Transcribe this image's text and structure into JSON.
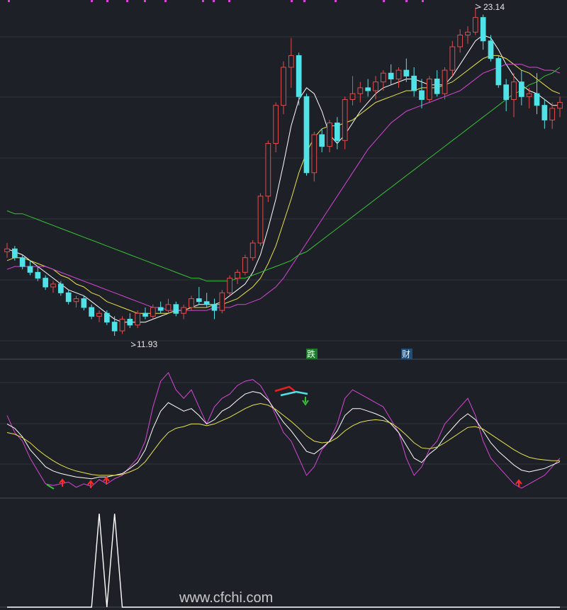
{
  "chart_data": [
    {
      "type": "candlestick",
      "panel": "main",
      "annotations": {
        "high_label": "23.14",
        "low_label": "11.93",
        "signal_1": "跌",
        "signal_2": "财"
      },
      "colors": {
        "up": "#e14c4c",
        "down": "#4fe3e8",
        "ma_short": "#ffffff",
        "ma_mid": "#e8e24a",
        "ma_long": "#d646d6",
        "ma_longest": "#35c235",
        "grid": "#30333b",
        "border": "#4a4d55"
      },
      "grid": true,
      "candles_ohlc": [
        [
          14.8,
          15.1,
          14.6,
          14.9
        ],
        [
          14.9,
          15.0,
          14.5,
          14.6
        ],
        [
          14.6,
          14.7,
          14.2,
          14.3
        ],
        [
          14.3,
          14.5,
          14.0,
          14.1
        ],
        [
          14.1,
          14.3,
          13.8,
          13.9
        ],
        [
          13.9,
          14.0,
          13.5,
          13.6
        ],
        [
          13.6,
          13.8,
          13.4,
          13.7
        ],
        [
          13.7,
          13.8,
          13.3,
          13.4
        ],
        [
          13.4,
          13.5,
          13.0,
          13.1
        ],
        [
          13.1,
          13.3,
          12.9,
          13.2
        ],
        [
          13.2,
          13.3,
          12.8,
          12.9
        ],
        [
          12.9,
          13.0,
          12.5,
          12.6
        ],
        [
          12.6,
          12.8,
          12.4,
          12.7
        ],
        [
          12.7,
          12.8,
          12.3,
          12.4
        ],
        [
          12.4,
          12.6,
          11.93,
          12.1
        ],
        [
          12.1,
          12.6,
          12.0,
          12.5
        ],
        [
          12.5,
          12.7,
          12.2,
          12.3
        ],
        [
          12.3,
          12.8,
          12.2,
          12.7
        ],
        [
          12.7,
          12.9,
          12.5,
          12.6
        ],
        [
          12.6,
          13.0,
          12.5,
          12.9
        ],
        [
          12.9,
          13.1,
          12.7,
          12.8
        ],
        [
          12.8,
          13.2,
          12.7,
          13.0
        ],
        [
          13.0,
          13.1,
          12.6,
          12.7
        ],
        [
          12.7,
          13.0,
          12.5,
          12.9
        ],
        [
          12.9,
          13.3,
          12.8,
          13.2
        ],
        [
          13.2,
          13.6,
          13.0,
          13.1
        ],
        [
          13.1,
          13.4,
          12.9,
          13.0
        ],
        [
          13.0,
          13.2,
          12.5,
          12.8
        ],
        [
          12.8,
          13.5,
          12.7,
          13.4
        ],
        [
          13.4,
          14.0,
          13.3,
          13.9
        ],
        [
          13.9,
          14.2,
          13.7,
          14.1
        ],
        [
          14.1,
          14.7,
          14.0,
          14.6
        ],
        [
          14.6,
          15.2,
          14.5,
          15.1
        ],
        [
          15.1,
          16.8,
          15.0,
          16.7
        ],
        [
          16.7,
          18.6,
          16.5,
          18.5
        ],
        [
          18.5,
          19.9,
          18.2,
          19.8
        ],
        [
          19.8,
          21.3,
          19.5,
          21.1
        ],
        [
          21.1,
          22.1,
          20.4,
          21.5
        ],
        [
          21.5,
          21.6,
          19.8,
          20.1
        ],
        [
          20.1,
          20.2,
          17.4,
          17.5
        ],
        [
          17.5,
          18.9,
          17.2,
          18.8
        ],
        [
          18.8,
          19.0,
          18.2,
          18.4
        ],
        [
          18.4,
          19.3,
          18.2,
          19.2
        ],
        [
          19.2,
          19.4,
          18.3,
          18.6
        ],
        [
          18.6,
          20.1,
          18.3,
          20.0
        ],
        [
          20.0,
          20.8,
          19.8,
          20.2
        ],
        [
          20.2,
          20.6,
          19.9,
          20.4
        ],
        [
          20.4,
          20.7,
          20.1,
          20.3
        ],
        [
          20.3,
          20.8,
          20.0,
          20.6
        ],
        [
          20.6,
          21.0,
          20.3,
          20.9
        ],
        [
          20.9,
          21.2,
          20.5,
          20.7
        ],
        [
          20.7,
          21.1,
          20.4,
          21.0
        ],
        [
          21.0,
          21.4,
          20.6,
          20.8
        ],
        [
          20.8,
          21.1,
          20.1,
          20.3
        ],
        [
          20.3,
          20.7,
          19.7,
          20.0
        ],
        [
          20.0,
          20.8,
          19.9,
          20.7
        ],
        [
          20.7,
          21.0,
          20.1,
          20.2
        ],
        [
          20.2,
          21.1,
          20.0,
          21.0
        ],
        [
          21.0,
          22.0,
          20.8,
          21.8
        ],
        [
          21.8,
          22.4,
          21.6,
          22.2
        ],
        [
          22.2,
          22.5,
          21.9,
          22.3
        ],
        [
          22.3,
          23.14,
          22.2,
          22.8
        ],
        [
          22.8,
          22.9,
          21.7,
          22.0
        ],
        [
          22.0,
          22.2,
          21.3,
          21.4
        ],
        [
          21.4,
          21.5,
          20.4,
          20.5
        ],
        [
          20.5,
          20.7,
          19.6,
          20.0
        ],
        [
          20.0,
          20.9,
          19.4,
          20.6
        ],
        [
          20.6,
          21.0,
          19.8,
          20.1
        ],
        [
          20.1,
          20.4,
          19.7,
          20.2
        ],
        [
          20.2,
          20.9,
          19.5,
          19.8
        ],
        [
          19.8,
          20.0,
          19.0,
          19.3
        ],
        [
          19.3,
          19.9,
          19.0,
          19.7
        ],
        [
          19.7,
          20.1,
          19.4,
          19.9
        ]
      ],
      "ma_series": [
        {
          "values": [
            14.9,
            14.8,
            14.7,
            14.5,
            14.3,
            14.1,
            13.9,
            13.7,
            13.5,
            13.4,
            13.3,
            13.1,
            12.9,
            12.7,
            12.5,
            12.4,
            12.4,
            12.4,
            12.4,
            12.5,
            12.6,
            12.7,
            12.8,
            12.8,
            12.9,
            13.0,
            13.0,
            13.0,
            13.1,
            13.3,
            13.5,
            13.7,
            14.1,
            14.7,
            15.6,
            16.6,
            17.8,
            19.1,
            20.0,
            20.4,
            20.2,
            19.6,
            18.8,
            18.5,
            18.8,
            19.2,
            19.6,
            19.9,
            20.2,
            20.4,
            20.5,
            20.6,
            20.7,
            20.7,
            20.6,
            20.5,
            20.5,
            20.5,
            20.8,
            21.2,
            21.6,
            22.0,
            22.2,
            22.1,
            21.7,
            21.2,
            20.8,
            20.5,
            20.3,
            20.2,
            20.0,
            19.8,
            19.8
          ]
        },
        {
          "values": [
            14.5,
            14.6,
            14.6,
            14.5,
            14.4,
            14.3,
            14.2,
            14.0,
            13.9,
            13.7,
            13.6,
            13.4,
            13.3,
            13.1,
            13.0,
            12.9,
            12.8,
            12.7,
            12.7,
            12.7,
            12.7,
            12.7,
            12.8,
            12.8,
            12.9,
            12.9,
            12.9,
            13.0,
            13.0,
            13.1,
            13.2,
            13.4,
            13.6,
            13.9,
            14.4,
            15.0,
            15.8,
            16.6,
            17.5,
            18.2,
            18.7,
            19.0,
            19.1,
            19.1,
            19.2,
            19.3,
            19.5,
            19.7,
            19.9,
            20.0,
            20.1,
            20.2,
            20.3,
            20.3,
            20.4,
            20.4,
            20.4,
            20.5,
            20.6,
            20.8,
            21.0,
            21.2,
            21.4,
            21.5,
            21.5,
            21.4,
            21.2,
            21.0,
            20.9,
            20.7,
            20.5,
            20.3,
            20.2
          ]
        },
        {
          "values": [
            14.2,
            14.3,
            14.3,
            14.3,
            14.3,
            14.3,
            14.2,
            14.1,
            14.0,
            13.9,
            13.8,
            13.7,
            13.6,
            13.5,
            13.4,
            13.3,
            13.2,
            13.1,
            13.0,
            12.9,
            12.9,
            12.8,
            12.8,
            12.8,
            12.8,
            12.8,
            12.8,
            12.9,
            12.9,
            12.9,
            13.0,
            13.0,
            13.1,
            13.2,
            13.4,
            13.6,
            13.9,
            14.3,
            14.7,
            15.1,
            15.5,
            15.9,
            16.3,
            16.7,
            17.1,
            17.5,
            17.9,
            18.3,
            18.6,
            18.9,
            19.2,
            19.4,
            19.6,
            19.7,
            19.8,
            19.9,
            20.0,
            20.1,
            20.2,
            20.3,
            20.5,
            20.7,
            20.9,
            21.0,
            21.1,
            21.2,
            21.2,
            21.2,
            21.1,
            21.1,
            21.0,
            21.0,
            20.9
          ]
        },
        {
          "values": [
            16.2,
            16.1,
            16.1,
            16.0,
            15.9,
            15.8,
            15.7,
            15.6,
            15.5,
            15.4,
            15.3,
            15.2,
            15.1,
            15.0,
            14.9,
            14.8,
            14.7,
            14.6,
            14.5,
            14.4,
            14.3,
            14.2,
            14.1,
            14.0,
            13.9,
            13.9,
            13.8,
            13.8,
            13.8,
            13.8,
            13.9,
            13.9,
            14.0,
            14.1,
            14.2,
            14.3,
            14.4,
            14.5,
            14.7,
            14.8,
            15.0,
            15.2,
            15.4,
            15.6,
            15.8,
            16.0,
            16.2,
            16.4,
            16.6,
            16.8,
            17.0,
            17.2,
            17.4,
            17.6,
            17.8,
            18.0,
            18.2,
            18.4,
            18.6,
            18.8,
            19.0,
            19.2,
            19.4,
            19.6,
            19.8,
            20.0,
            20.2,
            20.3,
            20.5,
            20.6,
            20.8,
            20.9,
            21.1
          ]
        }
      ]
    },
    {
      "type": "line",
      "panel": "oscillator",
      "series": [
        {
          "values": [
            50,
            30,
            20,
            0,
            -15,
            -30,
            -32,
            -30,
            -28,
            -34,
            -30,
            -33,
            -25,
            -30,
            -24,
            -20,
            -10,
            0,
            20,
            60,
            90,
            100,
            80,
            70,
            80,
            60,
            40,
            60,
            70,
            75,
            85,
            90,
            92,
            85,
            70,
            50,
            30,
            20,
            0,
            -20,
            -10,
            10,
            20,
            40,
            70,
            80,
            75,
            70,
            65,
            60,
            45,
            30,
            0,
            -20,
            -10,
            10,
            20,
            40,
            50,
            60,
            70,
            50,
            20,
            0,
            -10,
            -20,
            -30,
            -35,
            -30,
            -25,
            -20,
            -10,
            0
          ]
        },
        {
          "values": [
            40,
            35,
            25,
            10,
            0,
            -10,
            -15,
            -18,
            -20,
            -22,
            -23,
            -24,
            -22,
            -22,
            -20,
            -18,
            -12,
            -5,
            10,
            35,
            55,
            65,
            60,
            55,
            58,
            50,
            40,
            45,
            55,
            60,
            68,
            75,
            78,
            76,
            68,
            55,
            42,
            32,
            20,
            8,
            5,
            12,
            20,
            32,
            50,
            58,
            58,
            55,
            52,
            48,
            40,
            30,
            15,
            0,
            -5,
            5,
            12,
            25,
            35,
            45,
            52,
            45,
            32,
            18,
            8,
            0,
            -8,
            -14,
            -16,
            -14,
            -12,
            -8,
            -4
          ]
        },
        {
          "values": [
            30,
            28,
            24,
            18,
            10,
            3,
            -3,
            -8,
            -12,
            -15,
            -17,
            -19,
            -20,
            -20,
            -20,
            -19,
            -16,
            -12,
            -4,
            8,
            20,
            30,
            35,
            37,
            40,
            40,
            38,
            40,
            44,
            48,
            53,
            58,
            62,
            64,
            62,
            57,
            50,
            43,
            35,
            26,
            20,
            18,
            19,
            24,
            32,
            38,
            42,
            44,
            45,
            44,
            41,
            35,
            27,
            18,
            12,
            11,
            13,
            18,
            24,
            30,
            36,
            37,
            34,
            28,
            22,
            16,
            10,
            5,
            1,
            -1,
            -2,
            -3,
            -3
          ]
        }
      ]
    },
    {
      "type": "line",
      "panel": "indicator",
      "series": [
        {
          "values": [
            0,
            0,
            0,
            0,
            0,
            0,
            0,
            0,
            0,
            0,
            0,
            0,
            1,
            0,
            1,
            0,
            0,
            0,
            0,
            0,
            0,
            0,
            0,
            0,
            0,
            0,
            0,
            0,
            0,
            0,
            0,
            0,
            0,
            0,
            0,
            0,
            0,
            0,
            0,
            0,
            0,
            0,
            0,
            0,
            0,
            0,
            0,
            0,
            0,
            0,
            0,
            0,
            0,
            0,
            0,
            0,
            0,
            0,
            0,
            0,
            0,
            0,
            0,
            0,
            0,
            0,
            0,
            0,
            0,
            0,
            0,
            0,
            0
          ]
        }
      ]
    }
  ],
  "watermark": "www.cfchi.com",
  "top_bar_color": "#d646d6"
}
